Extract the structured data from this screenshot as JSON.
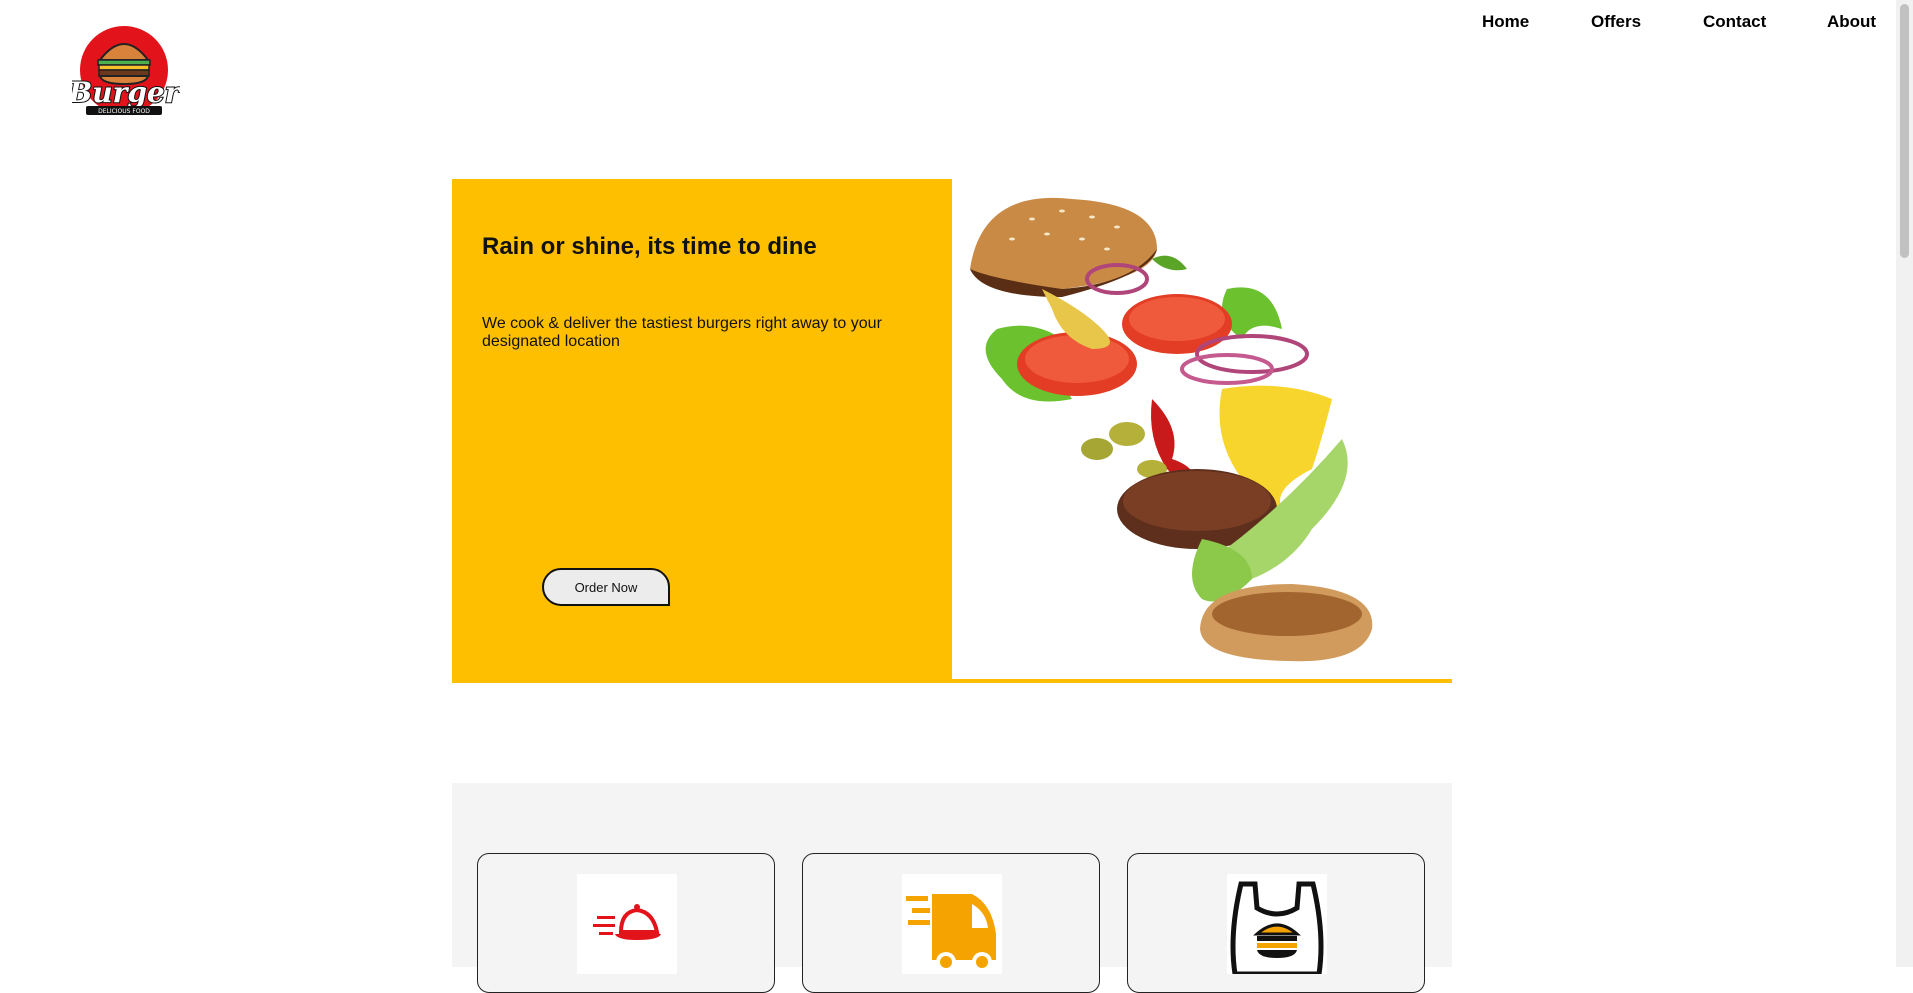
{
  "brand": {
    "logo_text": "Burger",
    "logo_subtext": "DELICIOUS FOOD"
  },
  "nav": {
    "items": [
      "Home",
      "Offers",
      "Contact",
      "About"
    ]
  },
  "hero": {
    "title": "Rain or shine, its time to dine",
    "text": "We cook & deliver the tastiest burgers right away to your designated location",
    "button_label": "Order Now",
    "image": "flying-burger-ingredients"
  },
  "services": {
    "icons": [
      "food-serving-cloche-icon",
      "delivery-truck-icon",
      "burger-takeaway-bag-icon"
    ]
  },
  "colors": {
    "accent": "#fdbf00",
    "icon_red": "#e3131b",
    "icon_orange": "#f5a300"
  }
}
